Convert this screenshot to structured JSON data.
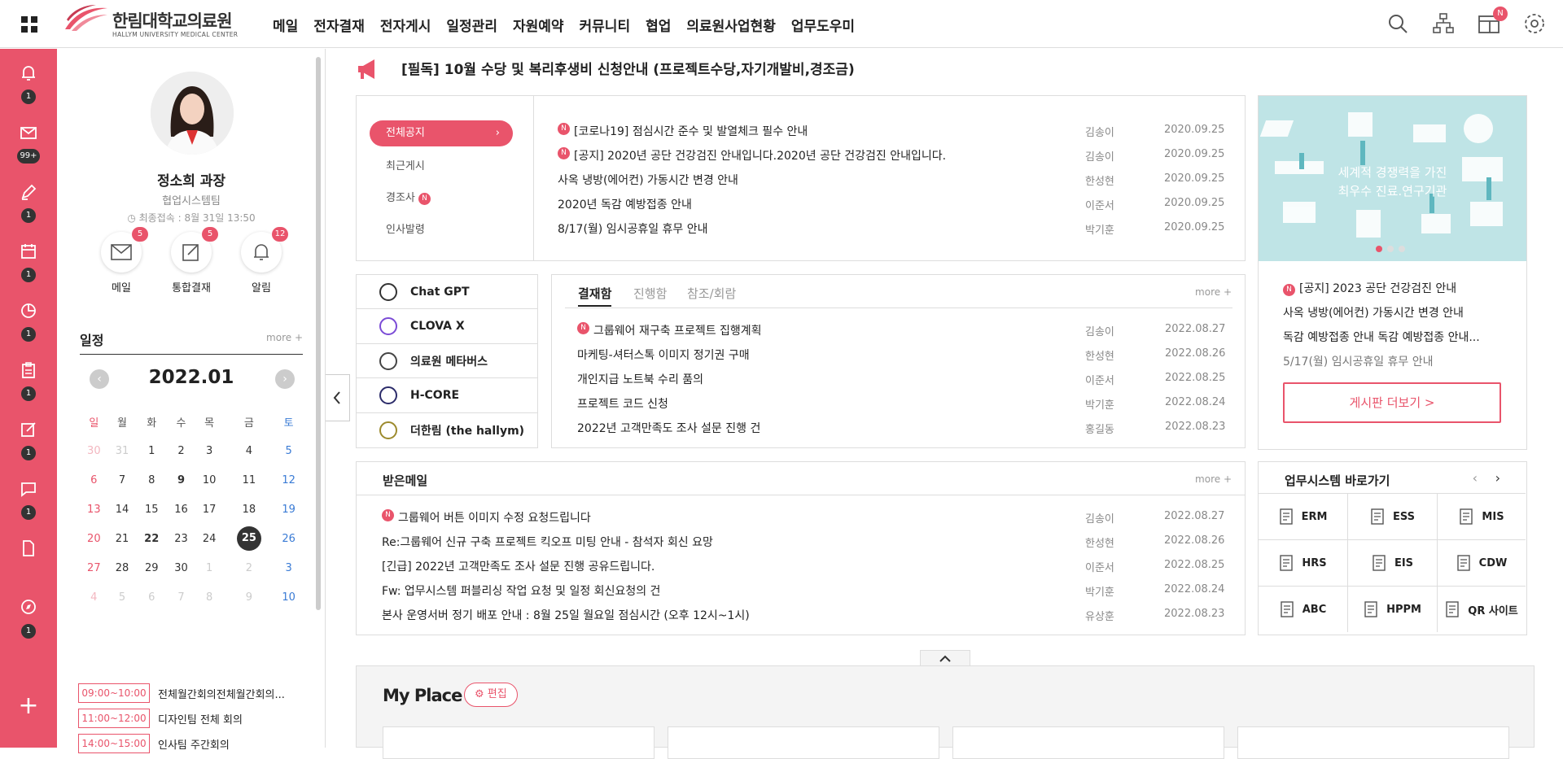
{
  "header": {
    "logo_kr": "한림대학교의료원",
    "logo_en": "HALLYM UNIVERSITY MEDICAL CENTER",
    "nav": [
      "메일",
      "전자결재",
      "전자게시",
      "일정관리",
      "자원예약",
      "커뮤니티",
      "협업",
      "의료원사업현황",
      "업무도우미"
    ],
    "badge": "N"
  },
  "leftbar": {
    "items": [
      {
        "icon": "bell-icon",
        "count": "1"
      },
      {
        "icon": "mail-icon",
        "count": "99+"
      },
      {
        "icon": "pen-icon",
        "count": "1"
      },
      {
        "icon": "calendar-icon",
        "count": "1"
      },
      {
        "icon": "pie-chart-icon",
        "count": "1"
      },
      {
        "icon": "clipboard-icon",
        "count": "1"
      },
      {
        "icon": "edit-icon",
        "count": "1"
      },
      {
        "icon": "chat-icon",
        "count": "1"
      },
      {
        "icon": "document-icon",
        "count": ""
      },
      {
        "icon": "compass-icon",
        "count": "1"
      }
    ],
    "add": "+"
  },
  "profile": {
    "name": "정소희 과장",
    "dept": "협업시스템팀",
    "last_login": "최종접속 : 8월 31일 13:50",
    "quick": [
      {
        "label": "메일",
        "count": "5"
      },
      {
        "label": "통합결재",
        "count": "5"
      },
      {
        "label": "알림",
        "count": "12"
      }
    ]
  },
  "schedule": {
    "title": "일정",
    "more": "more +",
    "month": "2022.01",
    "weekdays": [
      "일",
      "월",
      "화",
      "수",
      "목",
      "금",
      "토"
    ],
    "weeks": [
      [
        "30",
        "31",
        "1",
        "2",
        "3",
        "4",
        "5"
      ],
      [
        "6",
        "7",
        "8",
        "9",
        "10",
        "11",
        "12"
      ],
      [
        "13",
        "14",
        "15",
        "16",
        "17",
        "18",
        "19"
      ],
      [
        "20",
        "21",
        "22",
        "23",
        "24",
        "25",
        "26"
      ],
      [
        "27",
        "28",
        "29",
        "30",
        "1",
        "2",
        "3"
      ],
      [
        "4",
        "5",
        "6",
        "7",
        "8",
        "9",
        "10"
      ]
    ],
    "events": [
      {
        "time": "09:00~10:00",
        "title": "전체월간회의전체월간회의..."
      },
      {
        "time": "11:00~12:00",
        "title": "디자인팀 전체 회의"
      },
      {
        "time": "14:00~15:00",
        "title": "인사팀 주간회의"
      }
    ]
  },
  "notice": {
    "title": "[필독] 10월 수당 및 복리후생비 신청안내 (프로젝트수당,자기개발비,경조금)"
  },
  "board": {
    "tabs": [
      "전체공지",
      "최근게시",
      "경조사",
      "인사발령"
    ],
    "rows": [
      {
        "new": true,
        "title": "[코로나19] 점심시간 준수 및 발열체크 필수 안내",
        "author": "김송이",
        "date": "2020.09.25"
      },
      {
        "new": true,
        "title": "[공지] 2020년 공단 건강검진 안내입니다.2020년 공단 건강검진 안내입니다.",
        "author": "김송이",
        "date": "2020.09.25"
      },
      {
        "new": false,
        "title": "사옥 냉방(에어컨) 가동시간 변경 안내",
        "author": "한성현",
        "date": "2020.09.25"
      },
      {
        "new": false,
        "title": "2020년 독감 예방접종 안내",
        "author": "이준서",
        "date": "2020.09.25"
      },
      {
        "new": false,
        "title": "8/17(월) 임시공휴일 휴무 안내",
        "author": "박기훈",
        "date": "2020.09.25"
      }
    ]
  },
  "banner": {
    "line1": "세계적 경쟁력을 가진",
    "line2": "최우수 진료.연구기관",
    "list": [
      "[공지] 2023 공단 건강검진 안내",
      "사옥 냉방(에어컨) 가동시간 변경 안내",
      "독감 예방접종 안내 독감 예방접종 안내...",
      "5/17(월) 임시공휴일 휴무 안내"
    ],
    "button": "게시판 더보기 >"
  },
  "shortcuts": [
    {
      "label": "Chat GPT",
      "icon": "chatgpt-icon"
    },
    {
      "label": "CLOVA X",
      "icon": "clova-icon"
    },
    {
      "label": "의료원 메타버스",
      "icon": "metaverse-icon"
    },
    {
      "label": "H-CORE",
      "icon": "hcore-icon"
    },
    {
      "label": "더한림 (the hallym)",
      "icon": "hallym-icon"
    }
  ],
  "approval": {
    "tabs": [
      "결재함",
      "진행함",
      "참조/회람"
    ],
    "more": "more +",
    "rows": [
      {
        "new": true,
        "title": "그룹웨어 재구축 프로젝트 집행계획",
        "author": "김송이",
        "date": "2022.08.27"
      },
      {
        "new": false,
        "title": "마케팅-셔터스톡 이미지 정기권 구매",
        "author": "한성현",
        "date": "2022.08.26"
      },
      {
        "new": false,
        "title": "개인지급 노트북 수리 품의",
        "author": "이준서",
        "date": "2022.08.25"
      },
      {
        "new": false,
        "title": "프로젝트 코드 신청",
        "author": "박기훈",
        "date": "2022.08.24"
      },
      {
        "new": false,
        "title": "2022년 고객만족도 조사 설문 진행 건",
        "author": "홍길동",
        "date": "2022.08.23"
      }
    ]
  },
  "mail": {
    "title": "받은메일",
    "more": "more +",
    "rows": [
      {
        "new": true,
        "title": "그룹웨어 버튼 이미지 수정 요청드립니다",
        "author": "김송이",
        "date": "2022.08.27"
      },
      {
        "new": false,
        "title": "Re:그룹웨어 신규 구축 프로젝트 킥오프 미팅 안내 - 참석자 회신 요망",
        "author": "한성현",
        "date": "2022.08.26"
      },
      {
        "new": false,
        "title": "[긴급] 2022년 고객만족도 조사 설문 진행 공유드립니다.",
        "author": "이준서",
        "date": "2022.08.25"
      },
      {
        "new": false,
        "title": "Fw: 업무시스템 퍼블리싱 작업 요청 및 일정 회신요청의 건",
        "author": "박기훈",
        "date": "2022.08.24"
      },
      {
        "new": false,
        "title": "본사 운영서버 정기 배포 안내 : 8월 25일 월요일 점심시간 (오후 12시~1시)",
        "author": "유상훈",
        "date": "2022.08.23"
      }
    ]
  },
  "systems": {
    "title": "업무시스템 바로가기",
    "items": [
      "ERM",
      "ESS",
      "MIS",
      "HRS",
      "EIS",
      "CDW",
      "ABC",
      "HPPM",
      "QR 사이트"
    ]
  },
  "myplace": {
    "title": "My Place",
    "edit": "편집"
  }
}
